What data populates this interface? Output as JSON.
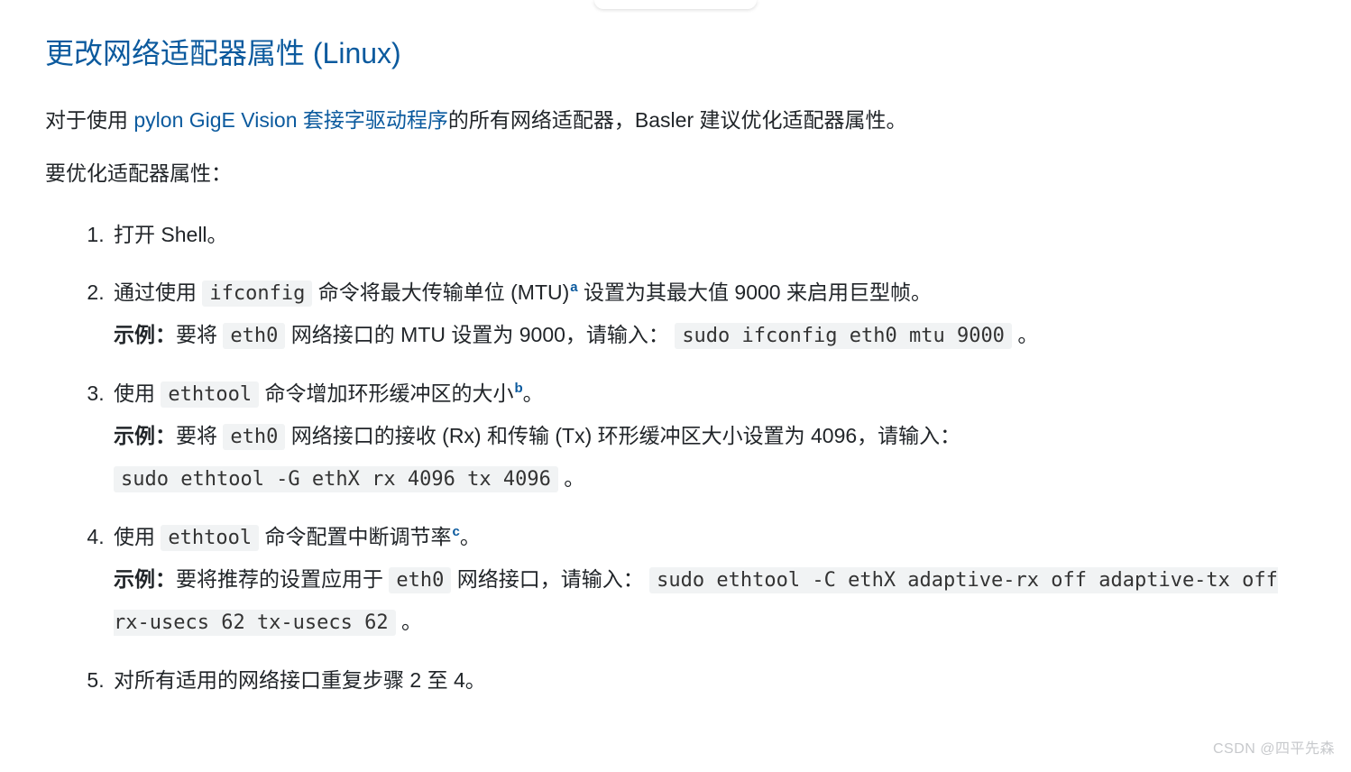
{
  "heading": "更改网络适配器属性 (Linux)",
  "intro": {
    "before_link": "对于使用 ",
    "link_text": "pylon GigE Vision 套接字驱动程序",
    "after_link": "的所有网络适配器，Basler 建议优化适配器属性。"
  },
  "intro2": "要优化适配器属性：",
  "steps": {
    "s1": "打开 Shell。",
    "s2": {
      "a": "通过使用 ",
      "code1": "ifconfig",
      "b": " 命令将最大传输单位 (MTU)",
      "sup": "a",
      "c": " 设置为其最大值 9000 来启用巨型帧。",
      "ex_label": "示例：",
      "ex_a": "要将 ",
      "ex_code1": "eth0",
      "ex_b": " 网络接口的 MTU 设置为 9000，请输入：",
      "ex_code2": "sudo ifconfig eth0 mtu 9000",
      "ex_tail": " 。"
    },
    "s3": {
      "a": "使用 ",
      "code1": "ethtool",
      "b": " 命令增加环形缓冲区的大小",
      "sup": "b",
      "c": "。",
      "ex_label": "示例：",
      "ex_a": "要将 ",
      "ex_code1": "eth0",
      "ex_b": " 网络接口的接收 (Rx) 和传输 (Tx) 环形缓冲区大小设置为 4096，请输入：",
      "ex_code2": "sudo ethtool -G ethX rx 4096 tx 4096",
      "ex_tail": " 。"
    },
    "s4": {
      "a": "使用 ",
      "code1": "ethtool",
      "b": " 命令配置中断调节率",
      "sup": "c",
      "c": "。",
      "ex_label": "示例：",
      "ex_a": "要将推荐的设置应用于 ",
      "ex_code1": "eth0",
      "ex_b": " 网络接口，请输入：",
      "ex_code2": "sudo ethtool -C ethX adaptive-rx off adaptive-tx off rx-usecs 62 tx-usecs 62",
      "ex_tail": " 。"
    },
    "s5": "对所有适用的网络接口重复步骤 2 至 4。"
  },
  "watermark": "CSDN @四平先森"
}
